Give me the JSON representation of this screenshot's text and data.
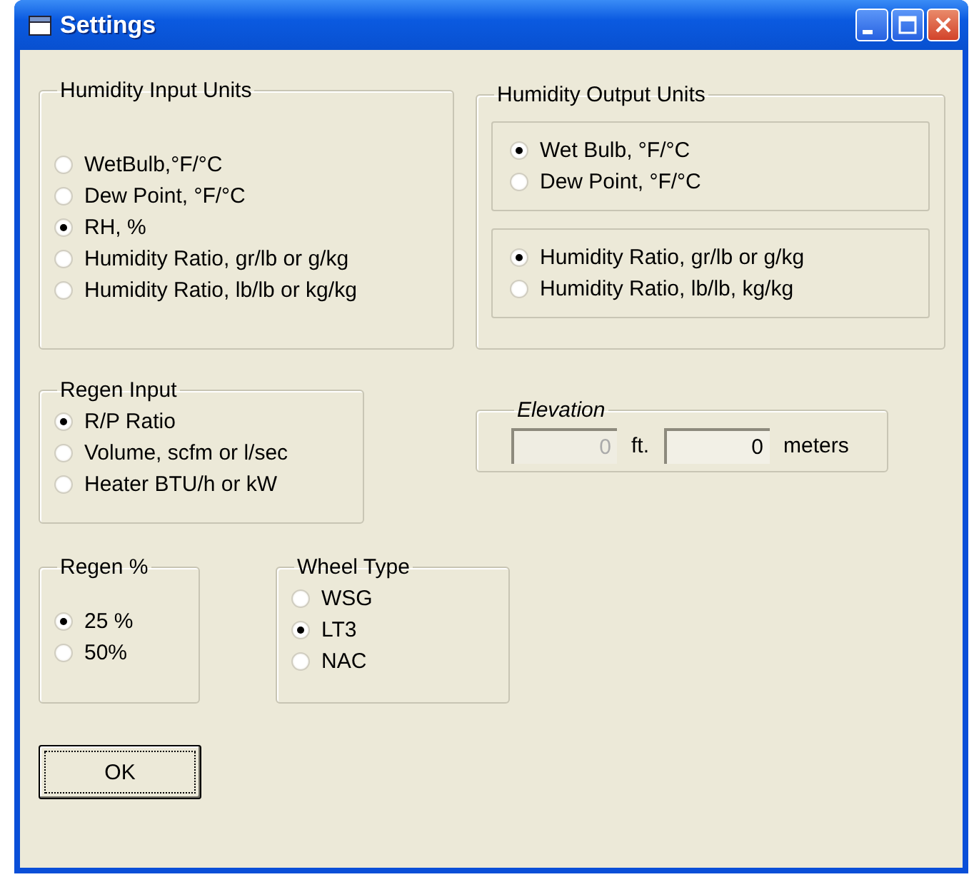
{
  "window": {
    "title": "Settings"
  },
  "humidity_input_units": {
    "label": "Humidity Input Units",
    "options": [
      {
        "label": "WetBulb,°F/°C",
        "selected": false
      },
      {
        "label": "Dew Point, °F/°C",
        "selected": false
      },
      {
        "label": "RH, %",
        "selected": true
      },
      {
        "label": "Humidity Ratio, gr/lb or g/kg",
        "selected": false
      },
      {
        "label": "Humidity Ratio, lb/lb or kg/kg",
        "selected": false
      }
    ]
  },
  "humidity_output_units": {
    "label": "Humidity Output Units",
    "groups": [
      {
        "options": [
          {
            "label": "Wet Bulb, °F/°C",
            "selected": true
          },
          {
            "label": "Dew Point, °F/°C",
            "selected": false
          }
        ]
      },
      {
        "options": [
          {
            "label": "Humidity Ratio, gr/lb or g/kg",
            "selected": true
          },
          {
            "label": "Humidity Ratio, lb/lb, kg/kg",
            "selected": false
          }
        ]
      }
    ]
  },
  "regen_input": {
    "label": "Regen Input",
    "options": [
      {
        "label": "R/P Ratio",
        "selected": true
      },
      {
        "label": "Volume, scfm or l/sec",
        "selected": false
      },
      {
        "label": "Heater BTU/h or kW",
        "selected": false
      }
    ]
  },
  "elevation": {
    "label": "Elevation",
    "feet": {
      "value": "0",
      "disabled": true
    },
    "feet_unit": "ft.",
    "meters": {
      "value": "0",
      "disabled": false
    },
    "meters_unit": "meters"
  },
  "regen_percent": {
    "label": "Regen %",
    "options": [
      {
        "label": "25 %",
        "selected": true
      },
      {
        "label": "50%",
        "selected": false
      }
    ]
  },
  "wheel_type": {
    "label": "Wheel Type",
    "options": [
      {
        "label": "WSG",
        "selected": false
      },
      {
        "label": "LT3",
        "selected": true
      },
      {
        "label": "NAC",
        "selected": false
      }
    ]
  },
  "ok_button": {
    "label": "OK"
  }
}
